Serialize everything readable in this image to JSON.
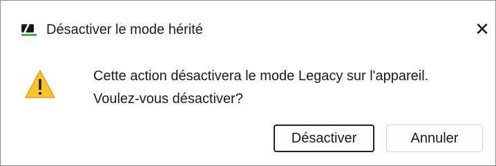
{
  "window": {
    "title": "Désactiver le mode hérité",
    "close_glyph": "✕",
    "app_icon": "sennheiser-logo-icon"
  },
  "content": {
    "icon": "warning-icon",
    "message_line1": "Cette action désactivera le mode Legacy sur l'appareil.",
    "message_line2": "Voulez-vous désactiver?"
  },
  "buttons": {
    "confirm_label": "Désactiver",
    "cancel_label": "Annuler"
  },
  "colors": {
    "warning": "#f8c42d",
    "logo_accent": "#3bb54a"
  }
}
